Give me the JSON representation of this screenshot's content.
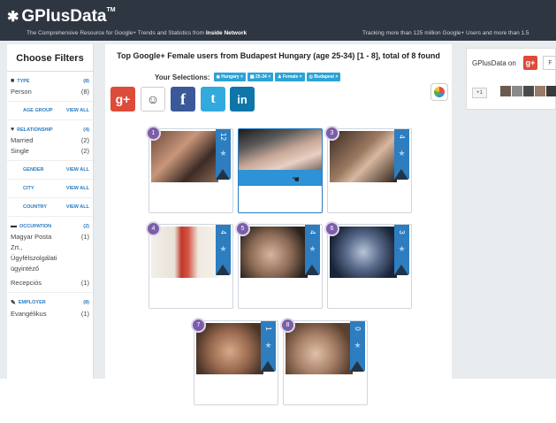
{
  "header": {
    "logo": "GPlusData",
    "tm": "TM",
    "tagline_pre": "The Comprehensive Resource for Google+ Trends and Statistics from ",
    "tagline_brand": "Inside Network",
    "tracking": "Tracking more than 125 million Google+ Users and more than 1.5"
  },
  "sidebar": {
    "title": "Choose Filters",
    "type": {
      "label": "TYPE",
      "count": "(8)",
      "rows": [
        {
          "label": "Person",
          "count": "(8)"
        }
      ]
    },
    "age_group": {
      "label": "AGE GROUP",
      "view_all": "VIEW ALL"
    },
    "relationship": {
      "label": "RELATIONSHIP",
      "count": "(4)",
      "rows": [
        {
          "label": "Married",
          "count": "(2)"
        },
        {
          "label": "Single",
          "count": "(2)"
        }
      ]
    },
    "gender": {
      "label": "GENDER",
      "view_all": "VIEW ALL"
    },
    "city": {
      "label": "CITY",
      "view_all": "VIEW ALL"
    },
    "country": {
      "label": "COUNTRY",
      "view_all": "VIEW ALL"
    },
    "occupation": {
      "label": "OCCUPATION",
      "count": "(2)",
      "rows": [
        {
          "label": "Magyar Posta",
          "count": "(1)"
        },
        {
          "label": "Zrt.,",
          "count": ""
        },
        {
          "label": "Ügyfélszolgálati",
          "count": ""
        },
        {
          "label": "ügyintéző",
          "count": ""
        },
        {
          "label": "Recepciós",
          "count": "(1)"
        }
      ]
    },
    "employer": {
      "label": "EMPLOYER",
      "count": "(8)",
      "rows": [
        {
          "label": "Evangélikus",
          "count": "(1)"
        }
      ]
    }
  },
  "main": {
    "title": "Top Google+ Female users from Budapest Hungary (age 25-34) [1 - 8], total of 8 found",
    "selections_label": "Your Selections:",
    "tags": [
      "Hungary ×",
      "25-34 ×",
      "Female ×",
      "Budapest ×"
    ],
    "social": {
      "gplus": "g+",
      "reddit": "☺",
      "facebook": "f",
      "twitter": "t",
      "linkedin": "in"
    },
    "cards": [
      {
        "rank": "1",
        "score": "12"
      },
      {
        "rank": "2",
        "score": ""
      },
      {
        "rank": "3",
        "score": "4"
      },
      {
        "rank": "4",
        "score": "4"
      },
      {
        "rank": "5",
        "score": "4"
      },
      {
        "rank": "6",
        "score": "3"
      },
      {
        "rank": "7",
        "score": "1"
      },
      {
        "rank": "8",
        "score": "0"
      }
    ]
  },
  "right": {
    "brand": "GPlusData",
    "on": " on",
    "gplus": "g+",
    "follow": "F",
    "plus1": "+1"
  },
  "colors": {
    "accent": "#2ba3d6",
    "ribbon": "#2d7dbf",
    "rank": "#7b5ea7",
    "header": "#2e3641"
  }
}
